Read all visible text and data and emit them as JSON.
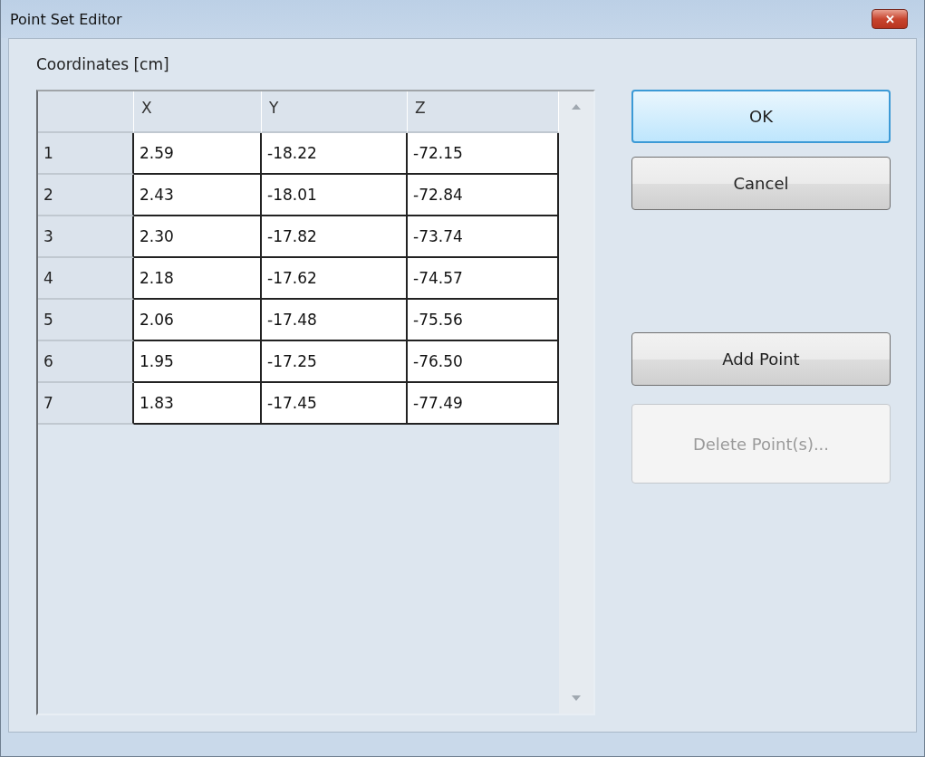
{
  "window": {
    "title": "Point Set Editor",
    "close_symbol": "✕"
  },
  "group_label": "Coordinates [cm]",
  "table": {
    "columns": [
      "X",
      "Y",
      "Z"
    ],
    "rows": [
      {
        "index": "1",
        "cells": [
          "2.59",
          "-18.22",
          "-72.15"
        ]
      },
      {
        "index": "2",
        "cells": [
          "2.43",
          "-18.01",
          "-72.84"
        ]
      },
      {
        "index": "3",
        "cells": [
          "2.30",
          "-17.82",
          "-73.74"
        ]
      },
      {
        "index": "4",
        "cells": [
          "2.18",
          "-17.62",
          "-74.57"
        ]
      },
      {
        "index": "5",
        "cells": [
          "2.06",
          "-17.48",
          "-75.56"
        ]
      },
      {
        "index": "6",
        "cells": [
          "1.95",
          "-17.25",
          "-76.50"
        ]
      },
      {
        "index": "7",
        "cells": [
          "1.83",
          "-17.45",
          "-77.49"
        ]
      }
    ]
  },
  "buttons": [
    {
      "label": "OK",
      "kind": "default",
      "disabled": false
    },
    {
      "label": "Cancel",
      "kind": "normal",
      "disabled": false
    },
    {
      "label": "Add Point",
      "kind": "normal",
      "disabled": false
    },
    {
      "label": "Delete Point(s)...",
      "kind": "normal",
      "disabled": true
    }
  ]
}
